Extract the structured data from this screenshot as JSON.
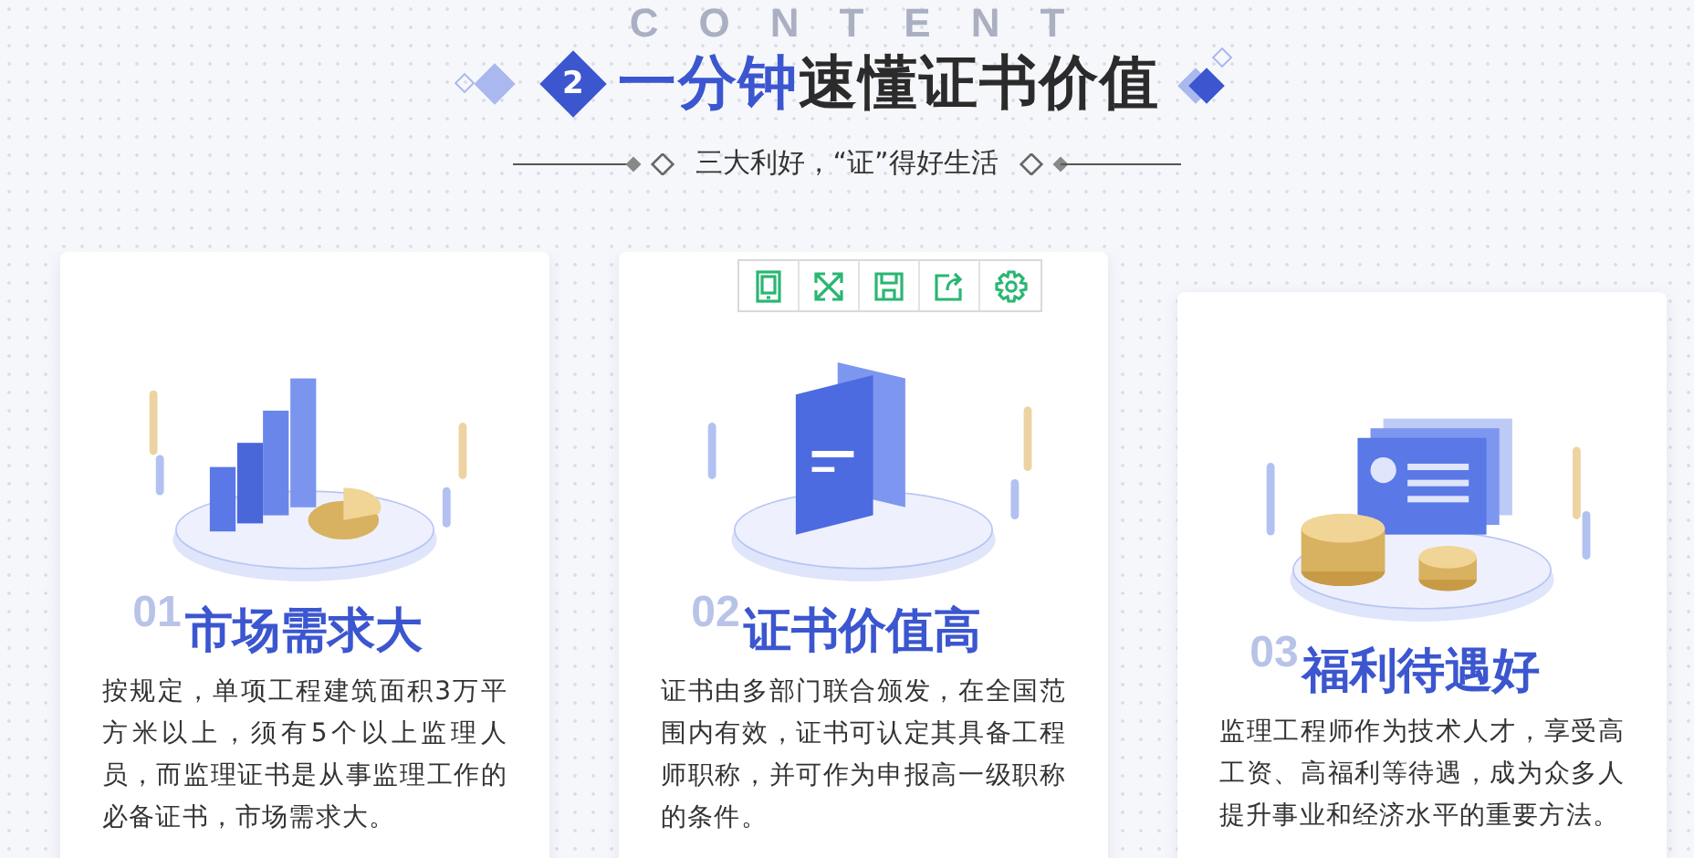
{
  "backdrop_text": "CONTENT",
  "heading": {
    "badge": "2",
    "highlight": "一分钟",
    "rest": "速懂证书价值"
  },
  "subtitle": "三大利好，“证”得好生活",
  "cards": [
    {
      "kind": "chart",
      "number": "01",
      "title": "市场需求大",
      "body": "按规定，单项工程建筑面积3万平方米以上，须有5个以上监理人员，而监理证书是从事监理工作的必备证书，市场需求大。"
    },
    {
      "kind": "certificate",
      "number": "02",
      "title": "证书价值高",
      "body": "证书由多部门联合颁发，在全国范围内有效，证书可认定其具备工程师职称，并可作为申报高一级职称的条件。"
    },
    {
      "kind": "coins",
      "number": "03",
      "title": "福利待遇好",
      "body": "监理工程师作为技术人才，享受高工资、高福利等待遇，成为众多人提升事业和经济水平的重要方法。"
    }
  ],
  "toolbar": [
    {
      "kind": "tablet"
    },
    {
      "kind": "expand"
    },
    {
      "kind": "save"
    },
    {
      "kind": "share"
    },
    {
      "kind": "settings"
    }
  ]
}
